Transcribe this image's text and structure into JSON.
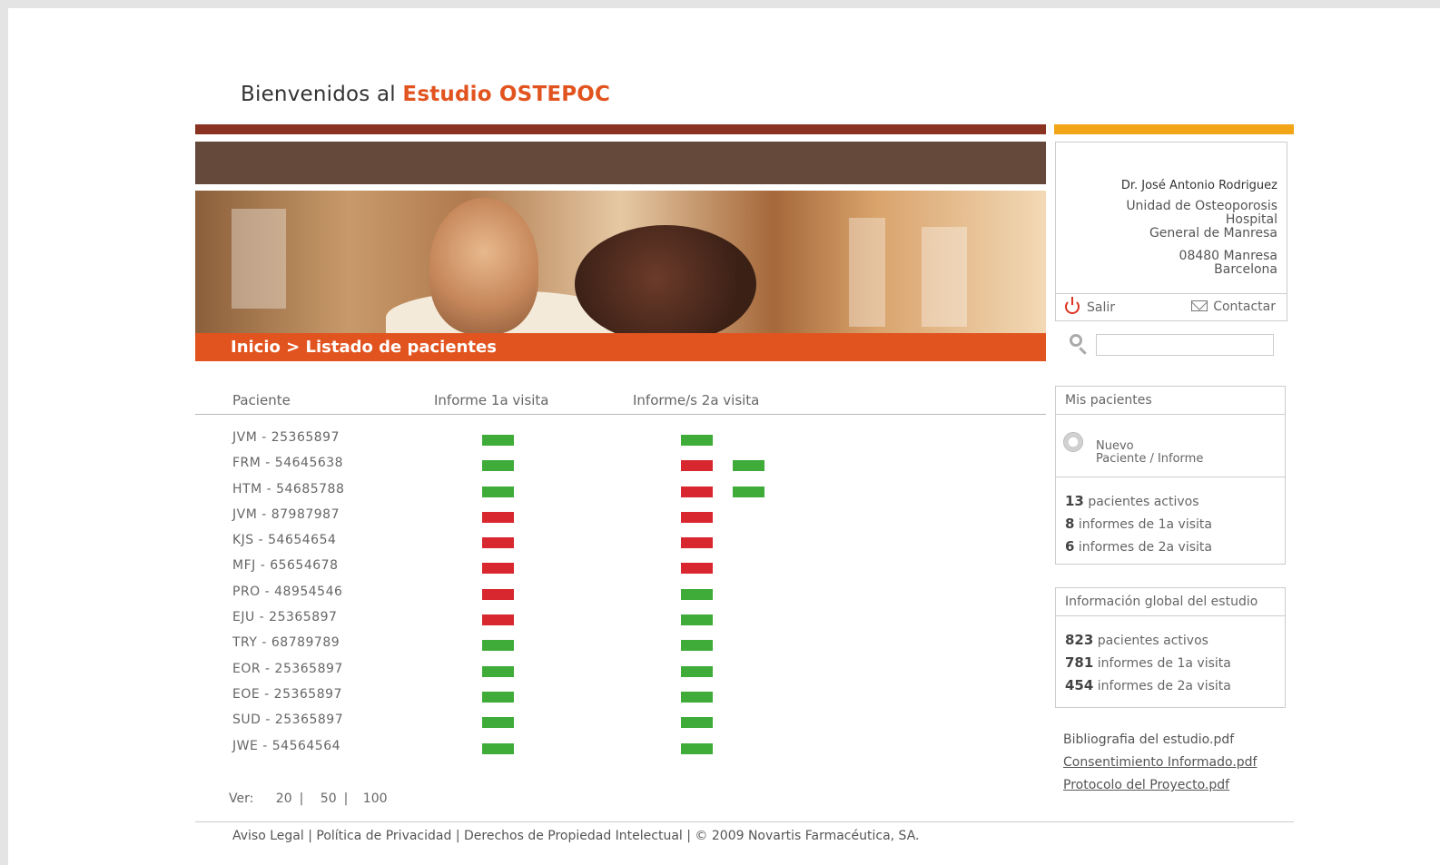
{
  "welcome": {
    "prefix": "Bienvenidos al",
    "brand": "Estudio OSTEPOC"
  },
  "breadcrumb": "Inicio > Listado de pacientes",
  "table": {
    "headers": [
      "Paciente",
      "Informe 1a visita",
      "Informe/s 2a visita"
    ],
    "rows": [
      {
        "id": "JVM - 25365897",
        "v1": "green",
        "v2": [
          "green"
        ]
      },
      {
        "id": "FRM - 54645638",
        "v1": "green",
        "v2": [
          "red",
          "green"
        ]
      },
      {
        "id": "HTM - 54685788",
        "v1": "green",
        "v2": [
          "red",
          "green"
        ]
      },
      {
        "id": "JVM - 87987987",
        "v1": "red",
        "v2": [
          "red"
        ]
      },
      {
        "id": "KJS - 54654654",
        "v1": "red",
        "v2": [
          "red"
        ]
      },
      {
        "id": "MFJ - 65654678",
        "v1": "red",
        "v2": [
          "red"
        ]
      },
      {
        "id": "PRO - 48954546",
        "v1": "red",
        "v2": [
          "green"
        ]
      },
      {
        "id": "EJU - 25365897",
        "v1": "red",
        "v2": [
          "green"
        ]
      },
      {
        "id": "TRY - 68789789",
        "v1": "green",
        "v2": [
          "green"
        ]
      },
      {
        "id": "EOR - 25365897",
        "v1": "green",
        "v2": [
          "green"
        ]
      },
      {
        "id": "EOE - 25365897",
        "v1": "green",
        "v2": [
          "green"
        ]
      },
      {
        "id": "SUD - 25365897",
        "v1": "green",
        "v2": [
          "green"
        ]
      },
      {
        "id": "JWE - 54564564",
        "v1": "green",
        "v2": [
          "green"
        ]
      }
    ]
  },
  "pagination": {
    "label": "Ver:",
    "options": [
      "20",
      "50",
      "100"
    ]
  },
  "footer": "Aviso Legal | Política de Privacidad | Derechos de Propiedad Intelectual | © 2009 Novartis Farmacéutica, SA.",
  "doctor": {
    "name": "Dr. José Antonio Rodriguez",
    "unit": "Unidad de Osteoporosis",
    "hospital1": "Hospital",
    "hospital2": "General de Manresa",
    "postal": "08480 Manresa",
    "city": "Barcelona"
  },
  "actions": {
    "logout": "Salir",
    "contact": "Contactar"
  },
  "search": {
    "placeholder": ""
  },
  "my_patients": {
    "title": "Mis pacientes",
    "new_line1": "Nuevo",
    "new_line2": "Paciente / Informe",
    "stats": [
      {
        "n": "13",
        "text": "pacientes activos"
      },
      {
        "n": "8",
        "text": "informes de 1a visita"
      },
      {
        "n": "6",
        "text": "informes de 2a visita"
      }
    ]
  },
  "global_info": {
    "title": "Información global del estudio",
    "stats": [
      {
        "n": "823",
        "text": "pacientes activos"
      },
      {
        "n": "781",
        "text": "informes de 1a visita"
      },
      {
        "n": "454",
        "text": "informes de 2a visita"
      }
    ]
  },
  "documents": [
    {
      "label": "Bibliografia del estudio.pdf",
      "underline": false
    },
    {
      "label": "Consentimiento Informado.pdf",
      "underline": true
    },
    {
      "label": "Protocolo del Proyecto.pdf",
      "underline": true
    }
  ],
  "colors": {
    "brand": "#e2541f",
    "green": "#3fac3a",
    "red": "#d9272f",
    "yellow": "#f2a516",
    "brown": "#65493a"
  }
}
